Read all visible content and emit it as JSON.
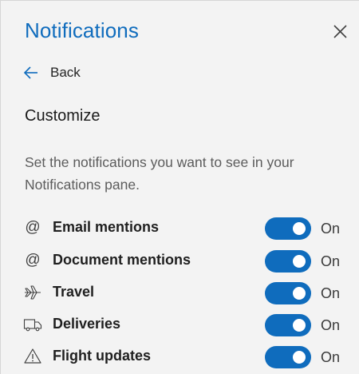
{
  "panel": {
    "title": "Notifications",
    "close_icon": "close-icon",
    "back": {
      "icon": "arrow-left-icon",
      "label": "Back"
    },
    "section_heading": "Customize",
    "description": "Set the notifications you want to see in your Notifications pane."
  },
  "settings": [
    {
      "icon": "at-icon",
      "glyph": "@",
      "label": "Email mentions",
      "state": "On",
      "enabled": true
    },
    {
      "icon": "at-icon",
      "glyph": "@",
      "label": "Document mentions",
      "state": "On",
      "enabled": true
    },
    {
      "icon": "airplane-icon",
      "glyph": "",
      "label": "Travel",
      "state": "On",
      "enabled": true
    },
    {
      "icon": "truck-icon",
      "glyph": "",
      "label": "Deliveries",
      "state": "On",
      "enabled": true
    },
    {
      "icon": "warning-icon",
      "glyph": "",
      "label": "Flight updates",
      "state": "On",
      "enabled": true
    }
  ],
  "colors": {
    "accent": "#0f6cbd",
    "background": "#f3f3f3",
    "description_text": "#5c5c5c"
  }
}
